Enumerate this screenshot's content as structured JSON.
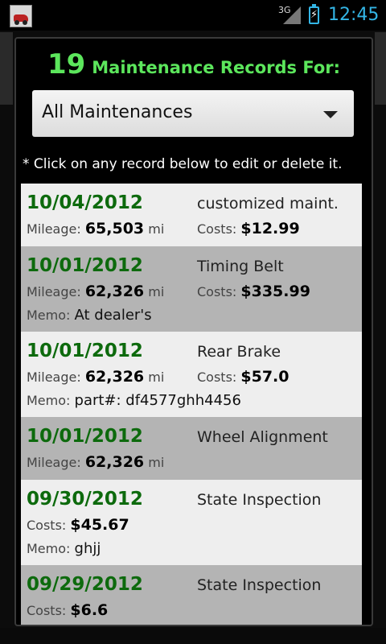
{
  "status_bar": {
    "network": "3G",
    "time": "12:45"
  },
  "dialog": {
    "count": "19",
    "title": "Maintenance Records For:",
    "filter": {
      "selected": "All Maintenances"
    },
    "hint": "* Click on any record below to edit or delete it."
  },
  "labels": {
    "mileage": "Mileage:",
    "costs": "Costs:",
    "memo": "Memo:",
    "unit": "mi"
  },
  "records": [
    {
      "date": "10/04/2012",
      "description": "customized maint.",
      "mileage": "65,503",
      "cost": "$12.99",
      "memo": ""
    },
    {
      "date": "10/01/2012",
      "description": "Timing Belt",
      "mileage": "62,326",
      "cost": "$335.99",
      "memo": "At dealer's"
    },
    {
      "date": "10/01/2012",
      "description": "Rear Brake",
      "mileage": "62,326",
      "cost": "$57.0",
      "memo": "part#: df4577ghh4456"
    },
    {
      "date": "10/01/2012",
      "description": "Wheel Alignment",
      "mileage": "62,326",
      "cost": "",
      "memo": ""
    },
    {
      "date": "09/30/2012",
      "description": "State Inspection",
      "mileage": "",
      "cost": "$45.67",
      "memo": "ghjj"
    },
    {
      "date": "09/29/2012",
      "description": "State Inspection",
      "mileage": "",
      "cost": "$6.6",
      "memo": ""
    }
  ]
}
